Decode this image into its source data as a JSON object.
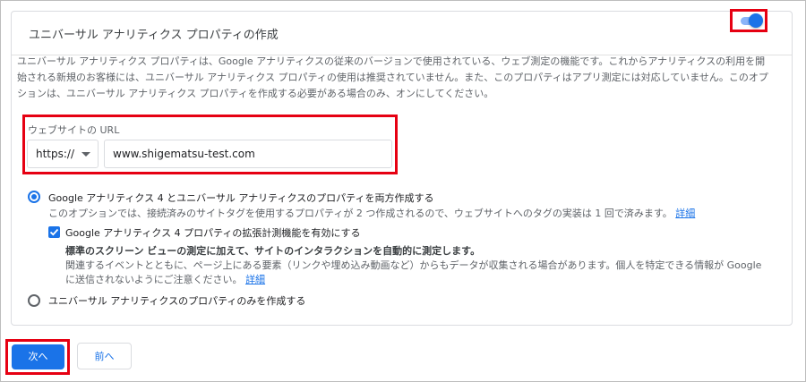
{
  "card": {
    "title": "ユニバーサル アナリティクス プロパティの作成",
    "toggle_state": "on",
    "description": "ユニバーサル アナリティクス プロパティは、Google アナリティクスの従来のバージョンで使用されている、ウェブ測定の機能です。これからアナリティクスの利用を開始される新規のお客様には、ユニバーサル アナリティクス プロパティの使用は推奨されていません。また、このプロパティはアプリ測定には対応していません。このオプションは、ユニバーサル アナリティクス プロパティを作成する必要がある場合のみ、オンにしてください。"
  },
  "url_section": {
    "label": "ウェブサイトの URL",
    "protocol": "https://",
    "url_value": "www.shigematsu-test.com"
  },
  "options": {
    "both": {
      "title": "Google アナリティクス 4 とユニバーサル アナリティクスのプロパティを両方作成する",
      "subtitle": "このオプションでは、接続済みのサイトタグを使用するプロパティが 2 つ作成されるので、ウェブサイトへのタグの実装は 1 回で済みます。",
      "link": "詳細",
      "selected": true
    },
    "enhanced": {
      "label": "Google アナリティクス 4 プロパティの拡張計測機能を有効にする",
      "strong": "標準のスクリーン ビューの測定に加えて、サイトのインタラクションを自動的に測定します。",
      "desc": "関連するイベントとともに、ページ上にある要素（リンクや埋め込み動画など）からもデータが収集される場合があります。個人を特定できる情報が Google に送信されないようにご注意ください。",
      "link": "詳細",
      "checked": true
    },
    "ua_only": {
      "title": "ユニバーサル アナリティクスのプロパティのみを作成する",
      "selected": false
    }
  },
  "buttons": {
    "next": "次へ",
    "prev": "前へ"
  },
  "colors": {
    "accent": "#1a73e8",
    "highlight": "#e60012"
  }
}
